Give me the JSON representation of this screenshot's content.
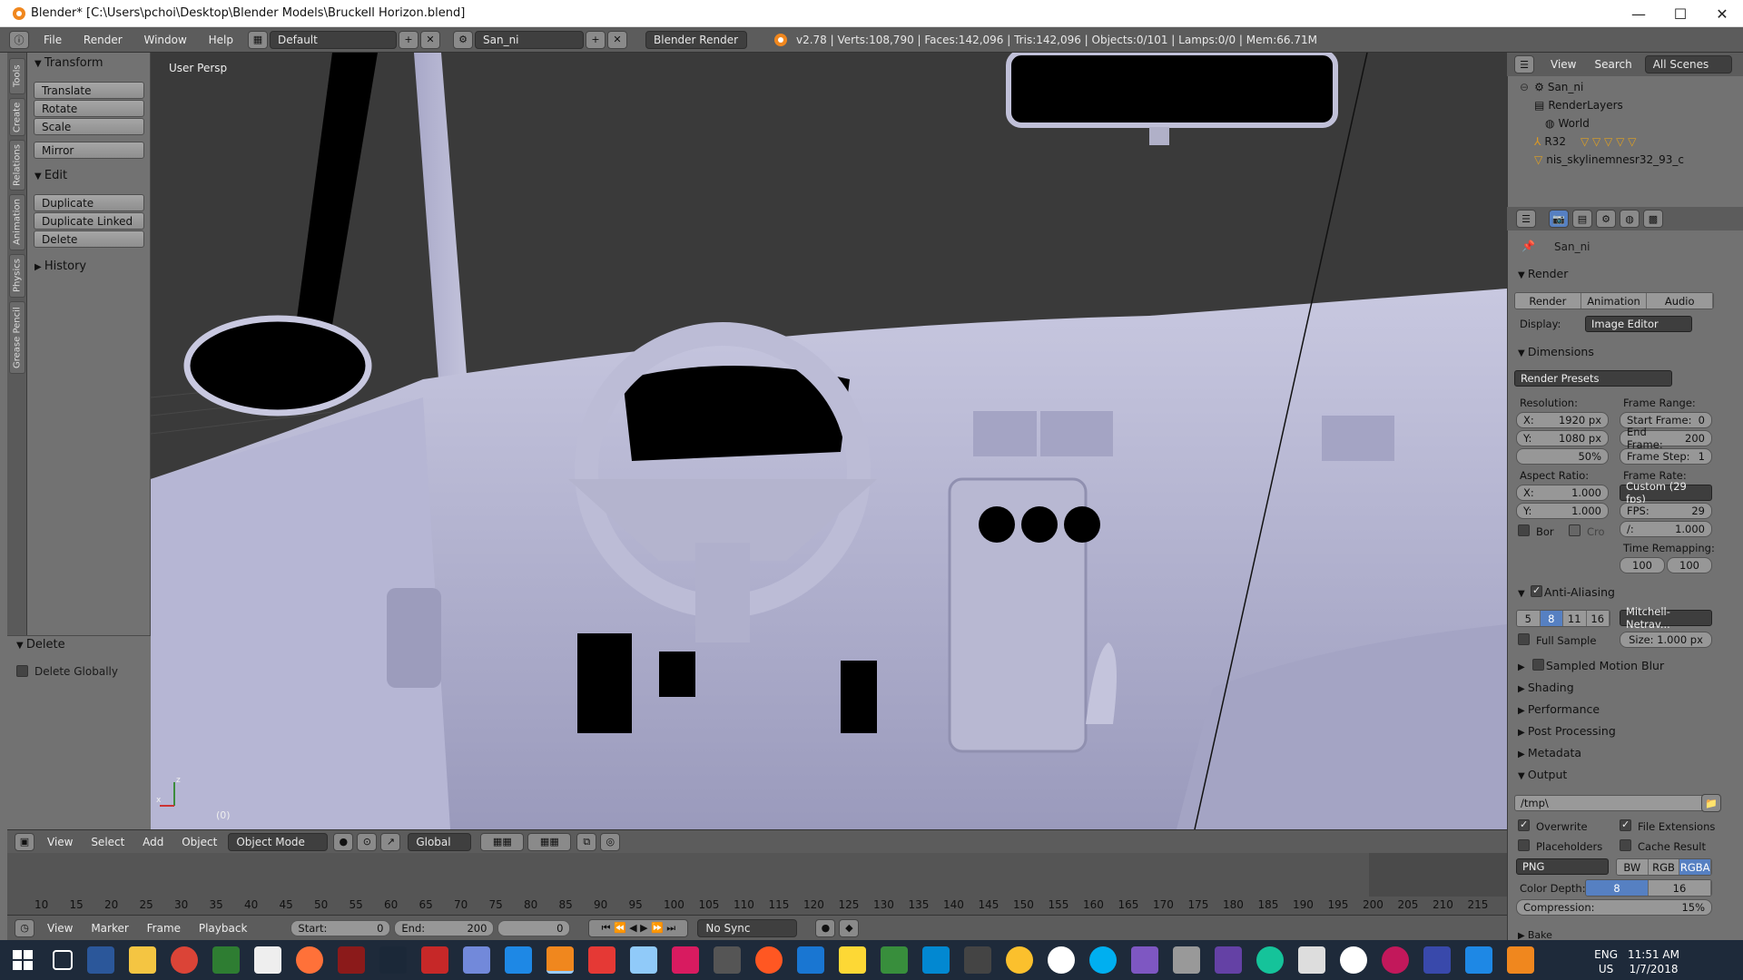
{
  "window": {
    "title": "Blender* [C:\\Users\\pchoi\\Desktop\\Blender Models\\Bruckell Horizon.blend]",
    "minimize": "—",
    "maximize": "☐",
    "close": "✕"
  },
  "topbar": {
    "menus": [
      "File",
      "Render",
      "Window",
      "Help"
    ],
    "screen_layout": "Default",
    "scene": "San_ni",
    "engine": "Blender Render",
    "stats": "v2.78 | Verts:108,790 | Faces:142,096 | Tris:142,096 | Objects:0/101 | Lamps:0/0 | Mem:66.71M"
  },
  "tabs": [
    "Tools",
    "Create",
    "Relations",
    "Animation",
    "Physics",
    "Grease Pencil"
  ],
  "toolshelf": {
    "transform_header": "Transform",
    "translate": "Translate",
    "rotate": "Rotate",
    "scale": "Scale",
    "mirror": "Mirror",
    "edit_header": "Edit",
    "duplicate": "Duplicate",
    "duplicate_linked": "Duplicate Linked",
    "delete": "Delete",
    "history_header": "History",
    "delete_panel_header": "Delete",
    "delete_globally": "Delete Globally"
  },
  "viewport": {
    "label": "User Persp",
    "frame_indicator": "(0)"
  },
  "viewport_header": {
    "menus": [
      "View",
      "Select",
      "Add",
      "Object"
    ],
    "mode": "Object Mode",
    "orientation": "Global"
  },
  "timeline": {
    "ticks": [
      "10",
      "15",
      "20",
      "25",
      "30",
      "35",
      "40",
      "45",
      "50",
      "55",
      "60",
      "65",
      "70",
      "75",
      "80",
      "85",
      "90",
      "95",
      "100",
      "105",
      "110",
      "115",
      "120",
      "125",
      "130",
      "135",
      "140",
      "145",
      "150",
      "155",
      "160",
      "165",
      "170",
      "175",
      "180",
      "185",
      "190",
      "195",
      "200",
      "205",
      "210",
      "215"
    ],
    "menus": [
      "View",
      "Marker",
      "Frame",
      "Playback"
    ],
    "start_label": "Start:",
    "start_value": "0",
    "end_label": "End:",
    "end_value": "200",
    "current": "0",
    "sync": "No Sync"
  },
  "outliner": {
    "menus": [
      "View",
      "Search"
    ],
    "display": "All Scenes",
    "items": [
      "San_ni",
      "RenderLayers",
      "World",
      "R32",
      "nis_skylinemnesr32_93_c"
    ]
  },
  "properties": {
    "scene_name": "San_ni",
    "render_header": "Render",
    "render_btn": "Render",
    "animation_btn": "Animation",
    "audio_btn": "Audio",
    "display_label": "Display:",
    "display_value": "Image Editor",
    "dimensions_header": "Dimensions",
    "render_presets": "Render Presets",
    "resolution_label": "Resolution:",
    "res_x_label": "X:",
    "res_x": "1920 px",
    "res_y_label": "Y:",
    "res_y": "1080 px",
    "res_pct": "50%",
    "frame_range_label": "Frame Range:",
    "start_frame_label": "Start Frame:",
    "start_frame": "0",
    "end_frame_label": "End Frame:",
    "end_frame": "200",
    "frame_step_label": "Frame Step:",
    "frame_step": "1",
    "aspect_label": "Aspect Ratio:",
    "asp_x_label": "X:",
    "asp_x": "1.000",
    "asp_y_label": "Y:",
    "asp_y": "1.000",
    "frame_rate_label": "Frame Rate:",
    "frame_rate": "Custom (29 fps)",
    "fps_label": "FPS:",
    "fps": "29",
    "base_label": "/:",
    "base": "1.000",
    "border_label": "Bor",
    "crop_label": "Cro",
    "time_remap_label": "Time Remapping:",
    "remap_old": "100",
    "remap_new": "100",
    "aa_header": "Anti-Aliasing",
    "aa_samples": [
      "5",
      "8",
      "11",
      "16"
    ],
    "aa_filter": "Mitchell-Netrav...",
    "full_sample": "Full Sample",
    "filter_size": "Size: 1.000 px",
    "motion_blur": "Sampled Motion Blur",
    "shading": "Shading",
    "performance": "Performance",
    "post_processing": "Post Processing",
    "metadata": "Metadata",
    "output_header": "Output",
    "output_path": "/tmp\\",
    "overwrite": "Overwrite",
    "file_extensions": "File Extensions",
    "placeholders": "Placeholders",
    "cache_result": "Cache Result",
    "format": "PNG",
    "color_modes": [
      "BW",
      "RGB",
      "RGBA"
    ],
    "color_depth_label": "Color Depth:",
    "depths": [
      "8",
      "16"
    ],
    "compression": "Compression:",
    "compression_value": "15%",
    "bake": "Bake"
  },
  "taskbar": {
    "lang1": "ENG",
    "lang2": "US",
    "time": "11:51 AM",
    "date": "1/7/2018"
  },
  "colors": {
    "accent": "#5680c2",
    "viewport_bg": "#393939",
    "model": "#b4b4d0"
  }
}
